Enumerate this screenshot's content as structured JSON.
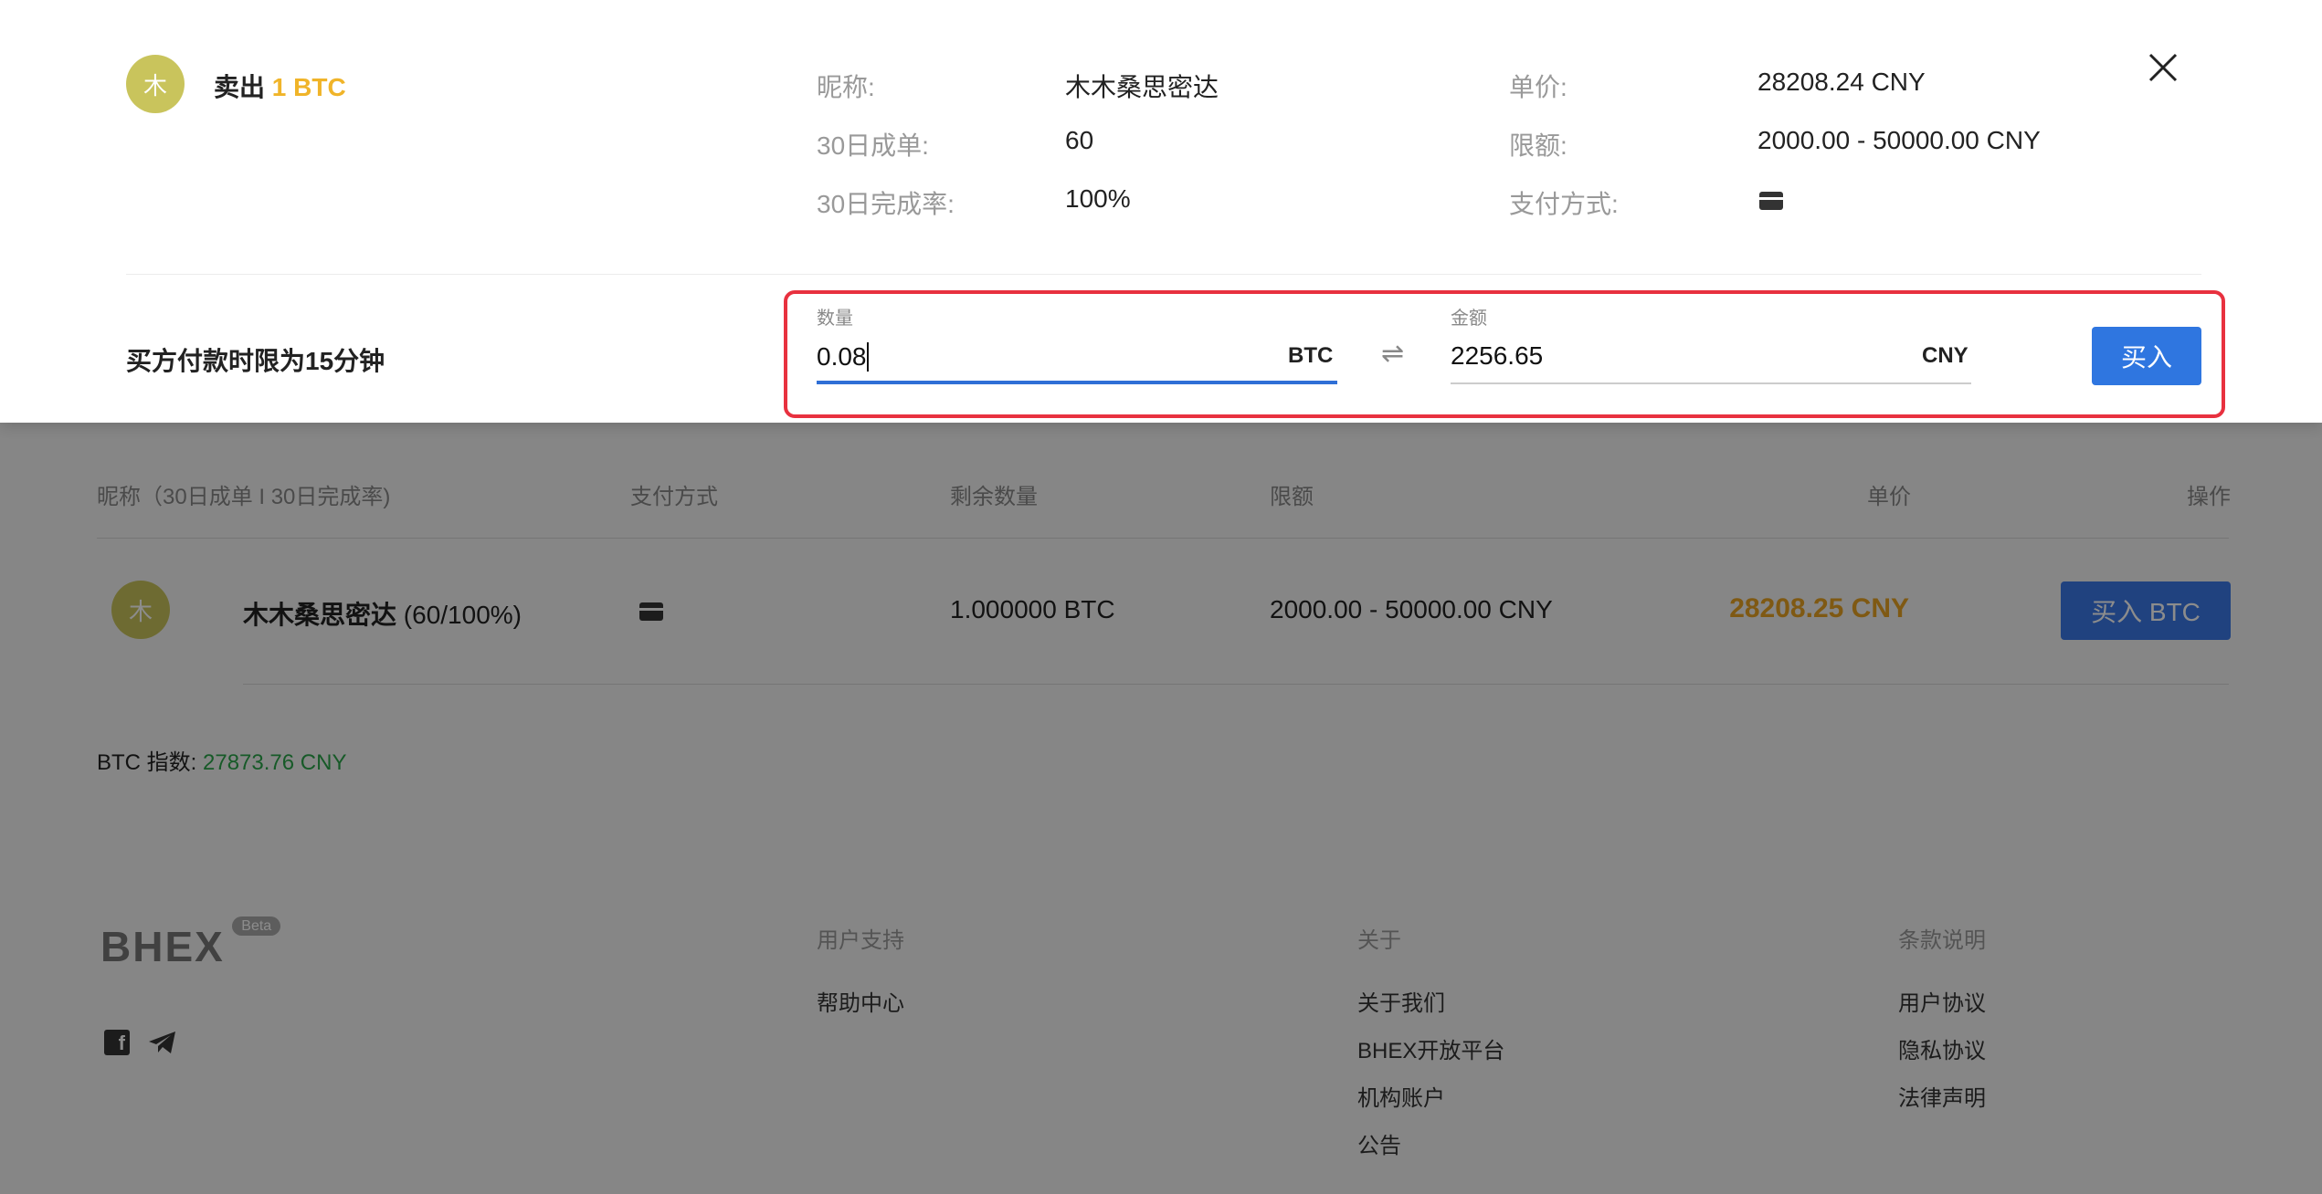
{
  "modal": {
    "avatar_char": "木",
    "title_prefix": "卖出",
    "title_amount": "1 BTC",
    "nickname_label": "昵称:",
    "nickname": "木木桑思密达",
    "orders_30d_label": "30日成单:",
    "orders_30d": "60",
    "completion_label": "30日完成率:",
    "completion": "100%",
    "price_label": "单价:",
    "price": "28208.24 CNY",
    "limit_label": "限额:",
    "limit": "2000.00 - 50000.00 CNY",
    "payment_label": "支付方式:",
    "payment_icon": "bank-card-icon",
    "deadline_text": "买方付款时限为15分钟",
    "quantity_label": "数量",
    "quantity_value": "0.08",
    "quantity_unit": "BTC",
    "swap_symbol": "⇌",
    "amount_label": "金额",
    "amount_value": "2256.65",
    "amount_unit": "CNY",
    "buy_button": "买入",
    "accent_color": "#2f76e0",
    "highlight_color": "#e8313f"
  },
  "table": {
    "headers": [
      "昵称（30日成单 I 30日完成率)",
      "支付方式",
      "剩余数量",
      "限额",
      "单价",
      "操作"
    ],
    "rows": [
      {
        "avatar_char": "木",
        "nickname": "木木桑思密达",
        "stats": "(60/100%)",
        "payment_icon": "bank-card-icon",
        "remaining": "1.000000 BTC",
        "limit": "2000.00 - 50000.00 CNY",
        "price": "28208.25 CNY",
        "action": "买入 BTC"
      }
    ]
  },
  "index": {
    "label": "BTC 指数:",
    "value": "27873.76 CNY"
  },
  "footer": {
    "logo": "BHEX",
    "beta": "Beta",
    "social_icons": [
      "facebook-icon",
      "telegram-icon"
    ],
    "columns": [
      {
        "title": "用户支持",
        "links": [
          "帮助中心"
        ]
      },
      {
        "title": "关于",
        "links": [
          "关于我们",
          "BHEX开放平台",
          "机构账户",
          "公告"
        ]
      },
      {
        "title": "条款说明",
        "links": [
          "用户协议",
          "隐私协议",
          "法律声明"
        ]
      }
    ]
  }
}
